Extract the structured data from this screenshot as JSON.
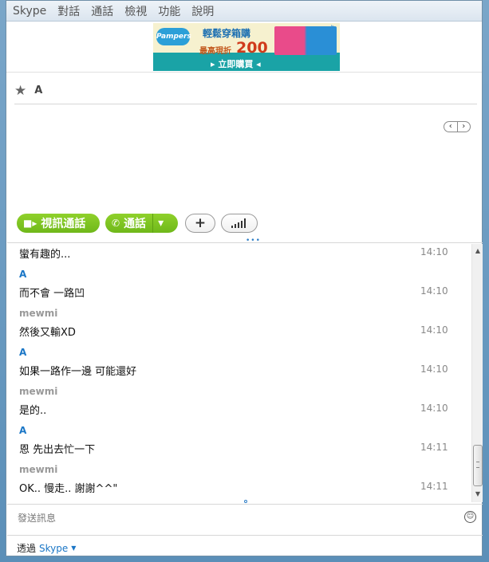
{
  "menu": {
    "items": [
      "Skype",
      "對話",
      "通話",
      "檢視",
      "功能",
      "說明"
    ]
  },
  "ad": {
    "brand": "Pampers",
    "headline": "輕鬆穿箱購",
    "sub_label": "最高現折",
    "amount": "200",
    "cta": "▸ 立即購買 ◂"
  },
  "contact": {
    "star_icon": "star-icon",
    "name": "A"
  },
  "pager": {
    "prev": "‹",
    "next": "›"
  },
  "buttons": {
    "video_label": "視訊通話",
    "call_label": "通話",
    "add_symbol": "+",
    "call_dropdown": "▾"
  },
  "messages": [
    {
      "sender": "",
      "text": "蠻有趣的...",
      "time": "14:10"
    },
    {
      "sender": "A",
      "text": "而不會 一路凹",
      "time": "14:10"
    },
    {
      "sender": "mewmi",
      "text": "然後又輸XD",
      "time": "14:10"
    },
    {
      "sender": "A",
      "text": "如果一路作一邊 可能還好",
      "time": "14:10"
    },
    {
      "sender": "mewmi",
      "text": "是的..",
      "time": "14:10"
    },
    {
      "sender": "A",
      "text": "恩 先出去忙一下",
      "time": "14:11"
    },
    {
      "sender": "mewmi",
      "text": "OK.. 慢走.. 謝謝^^\"",
      "time": "14:11"
    }
  ],
  "colors": {
    "sender_A": "#1a76c6",
    "sender_mewmi": "#999999",
    "green_button": "#7cc21f"
  },
  "input": {
    "placeholder": "發送訊息"
  },
  "footer": {
    "prefix": "透過",
    "link": "Skype"
  }
}
